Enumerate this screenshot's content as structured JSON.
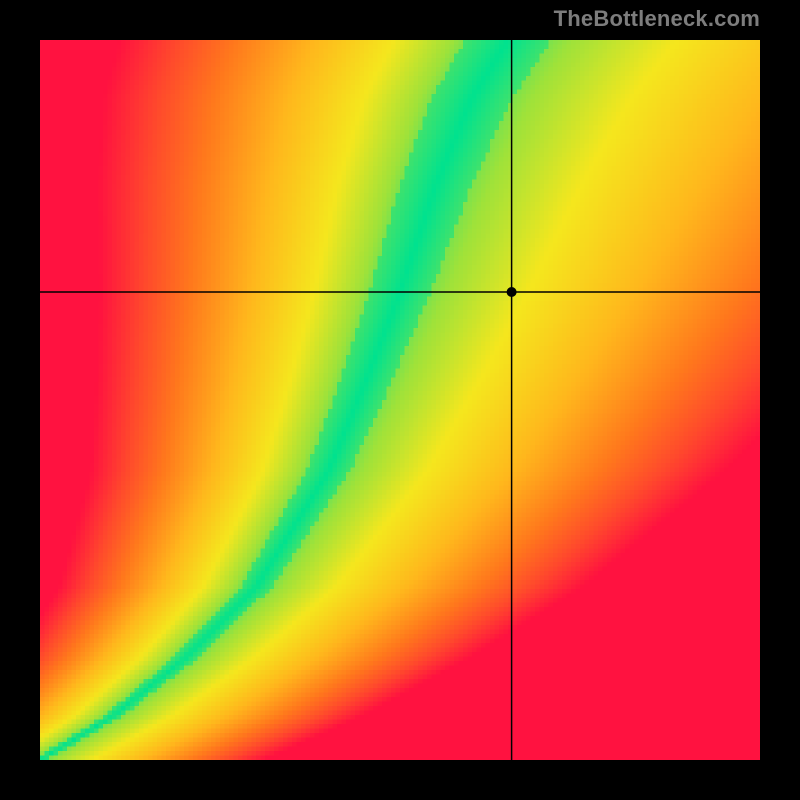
{
  "watermark": "TheBottleneck.com",
  "chart_data": {
    "type": "heatmap",
    "title": "",
    "xlabel": "",
    "ylabel": "",
    "xlim": [
      0,
      1
    ],
    "ylim": [
      0,
      1
    ],
    "crosshair": {
      "x": 0.655,
      "y": 0.65
    },
    "marker": {
      "x": 0.655,
      "y": 0.65,
      "r": 5
    },
    "ridge": {
      "description": "locus of optimal (green) values; monotonically increasing, s-shaped",
      "points": [
        {
          "x": 0.0,
          "y": 0.0
        },
        {
          "x": 0.1,
          "y": 0.06
        },
        {
          "x": 0.2,
          "y": 0.14
        },
        {
          "x": 0.3,
          "y": 0.24
        },
        {
          "x": 0.4,
          "y": 0.4
        },
        {
          "x": 0.45,
          "y": 0.52
        },
        {
          "x": 0.5,
          "y": 0.65
        },
        {
          "x": 0.55,
          "y": 0.8
        },
        {
          "x": 0.6,
          "y": 0.92
        },
        {
          "x": 0.65,
          "y": 1.0
        }
      ]
    },
    "ridge_width": {
      "description": "half-width of green band in x-units as function of y",
      "points": [
        {
          "y": 0.0,
          "w": 0.01
        },
        {
          "y": 0.2,
          "w": 0.02
        },
        {
          "y": 0.4,
          "w": 0.03
        },
        {
          "y": 0.6,
          "w": 0.04
        },
        {
          "y": 0.8,
          "w": 0.05
        },
        {
          "y": 1.0,
          "w": 0.06
        }
      ]
    },
    "color_stops": [
      {
        "t": 0.0,
        "color": "#00e28f"
      },
      {
        "t": 0.15,
        "color": "#9fe23a"
      },
      {
        "t": 0.3,
        "color": "#f5e71e"
      },
      {
        "t": 0.5,
        "color": "#ffb81c"
      },
      {
        "t": 0.7,
        "color": "#ff7a1c"
      },
      {
        "t": 0.85,
        "color": "#ff4a2c"
      },
      {
        "t": 1.0,
        "color": "#ff1240"
      }
    ],
    "grid": false,
    "legend": false,
    "resolution": 160
  }
}
